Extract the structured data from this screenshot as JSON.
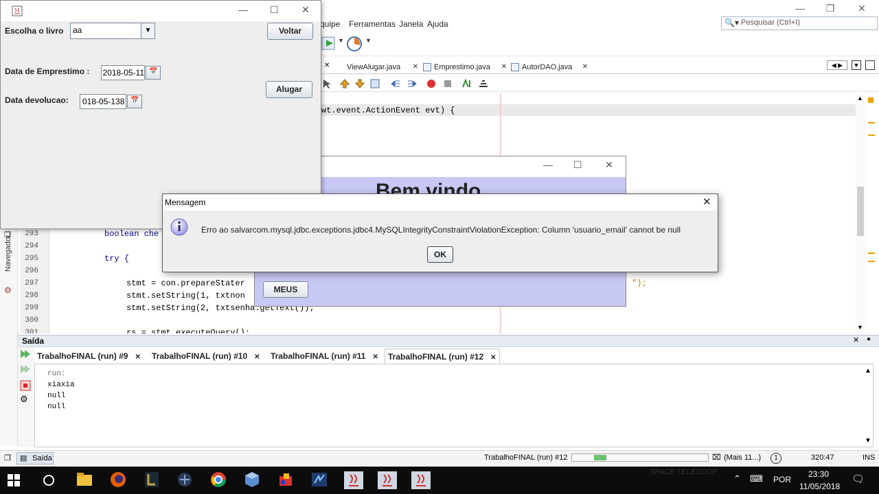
{
  "ide": {
    "menu": [
      "quipe",
      "Ferramentas",
      "Janela",
      "Ajuda"
    ],
    "search_placeholder": "Pesquisar (Ctrl+I)",
    "editor_tabs": [
      {
        "label": "ViewAlugar.java"
      },
      {
        "label": "Emprestimo.java"
      },
      {
        "label": "AutorDAO.java"
      }
    ],
    "code": {
      "highlighted_line": "wt.event.ActionEvent evt) {",
      "lines": [
        {
          "no": "293",
          "text": "boolean che"
        },
        {
          "no": "294",
          "text": ""
        },
        {
          "no": "295",
          "text": "try {"
        },
        {
          "no": "296",
          "text": ""
        },
        {
          "no": "297",
          "text": "stmt = con.prepareStater"
        },
        {
          "no": "298",
          "text": "stmt.setString(1, txtnon"
        },
        {
          "no": "299",
          "text": "stmt.setString(2, txtsenha.getText());"
        },
        {
          "no": "300",
          "text": ""
        },
        {
          "no": "301",
          "text": "rs = stmt.executeQuery();"
        }
      ],
      "line_297_tail": "\");"
    },
    "navigator_label": "Navegador",
    "output": {
      "title": "Saída",
      "tabs": [
        {
          "label": "TrabalhoFINAL (run) #9"
        },
        {
          "label": "TrabalhoFINAL (run) #10"
        },
        {
          "label": "TrabalhoFINAL (run) #11"
        },
        {
          "label": "TrabalhoFINAL (run) #12"
        }
      ],
      "lines": [
        "run:",
        "xiaxia",
        "null",
        "null"
      ]
    },
    "status": {
      "panel_label": "Saída",
      "task": "TrabalhoFINAL (run) #12",
      "progress": 0.12,
      "more": "(Mais 11...)",
      "notifications": "1",
      "position": "320:47",
      "mode": "INS"
    }
  },
  "alugar_frame": {
    "escolha_label": "Escolha o livro",
    "livro_value": "aa",
    "voltar_button": "Voltar",
    "data_emprestimo_label": "Data de Emprestimo :",
    "data_emprestimo_value": "2018-05-11",
    "alugar_button": "Alugar",
    "data_devolucao_label": "Data devolucao:",
    "data_devolucao_value": "018-05-138"
  },
  "welcome_frame": {
    "heading": "Bem vindo",
    "meus_button": "MEUS"
  },
  "message_dialog": {
    "title": "Mensagem",
    "message": "Erro ao salvarcom.mysql.jdbc.exceptions.jdbc4.MySQLIntegrityConstraintViolationException: Column 'usuario_email' cannot be null",
    "ok_button": "OK"
  },
  "taskbar": {
    "language": "POR",
    "time": "23:30",
    "date": "11/05/2018",
    "watermark": "SPACE TELESCOP"
  },
  "colors": {
    "welcome_bg": "#c8c8f5",
    "progress_fill": "#6cc16c",
    "taskbar_bg": "#0c0c0c"
  }
}
